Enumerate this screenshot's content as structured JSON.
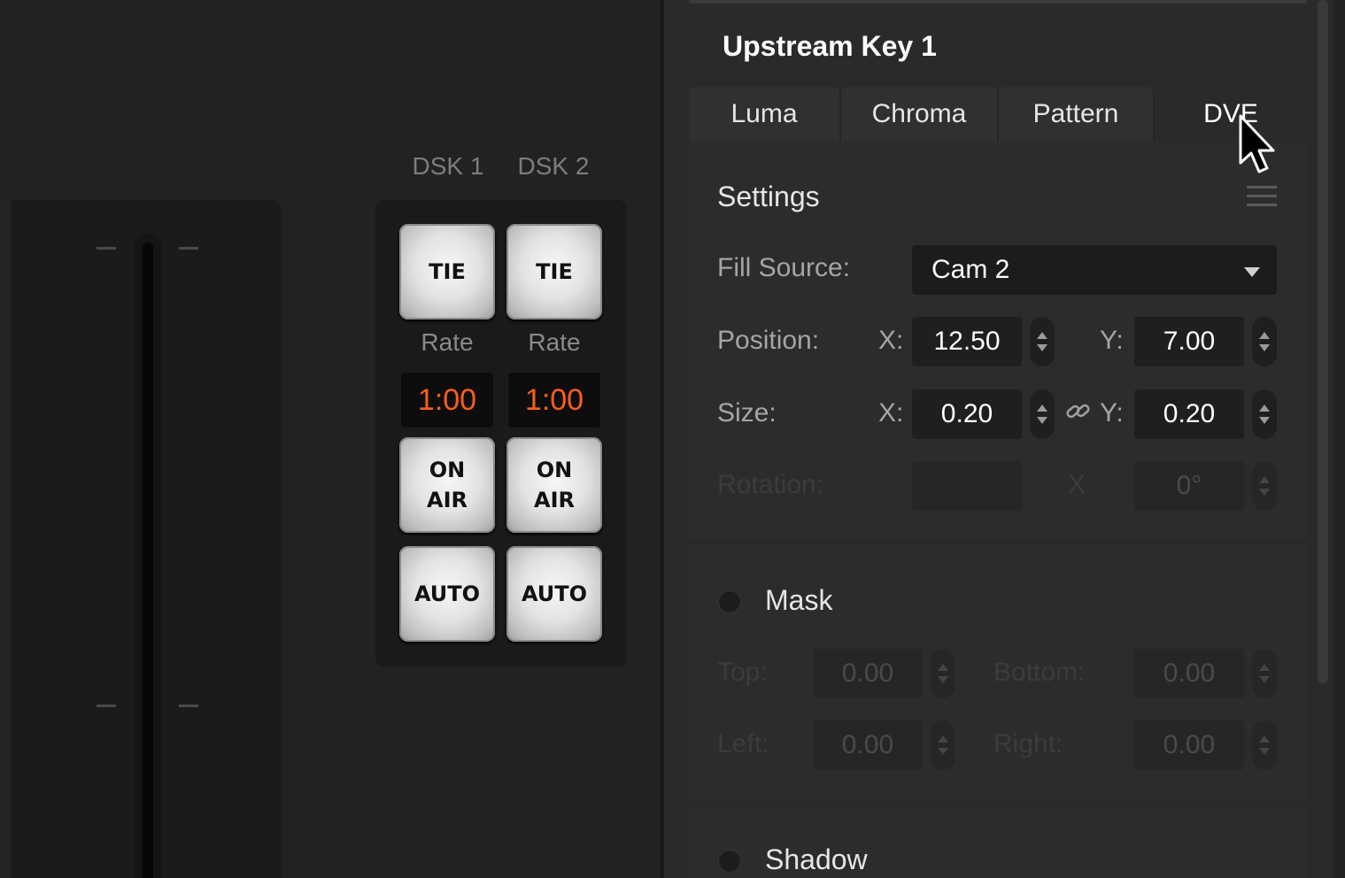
{
  "dsk": {
    "columns": [
      {
        "label": "DSK 1",
        "tie": "TIE",
        "rate_label": "Rate",
        "rate": "1:00",
        "on_air": [
          "ON",
          "AIR"
        ],
        "auto": "AUTO"
      },
      {
        "label": "DSK 2",
        "tie": "TIE",
        "rate_label": "Rate",
        "rate": "1:00",
        "on_air": [
          "ON",
          "AIR"
        ],
        "auto": "AUTO"
      }
    ],
    "rate_color": "#ff5e1a"
  },
  "panel": {
    "title": "Upstream Key 1",
    "tabs": [
      "Luma",
      "Chroma",
      "Pattern",
      "DVE"
    ],
    "active_tab": "DVE"
  },
  "settings": {
    "title": "Settings",
    "fill_source_label": "Fill Source:",
    "fill_source_value": "Cam 2",
    "position_label": "Position:",
    "position_x_label": "X:",
    "position_x": "12.50",
    "position_y_label": "Y:",
    "position_y": "7.00",
    "size_label": "Size:",
    "size_x_label": "X:",
    "size_x": "0.20",
    "size_y_label": "Y:",
    "size_y": "0.20",
    "rotation_label": "Rotation:",
    "rotation_x_label": "X",
    "rotation_value": "0°"
  },
  "mask": {
    "title": "Mask",
    "top_label": "Top:",
    "top": "0.00",
    "bottom_label": "Bottom:",
    "bottom": "0.00",
    "left_label": "Left:",
    "left": "0.00",
    "right_label": "Right:",
    "right": "0.00"
  },
  "shadow": {
    "title": "Shadow"
  }
}
